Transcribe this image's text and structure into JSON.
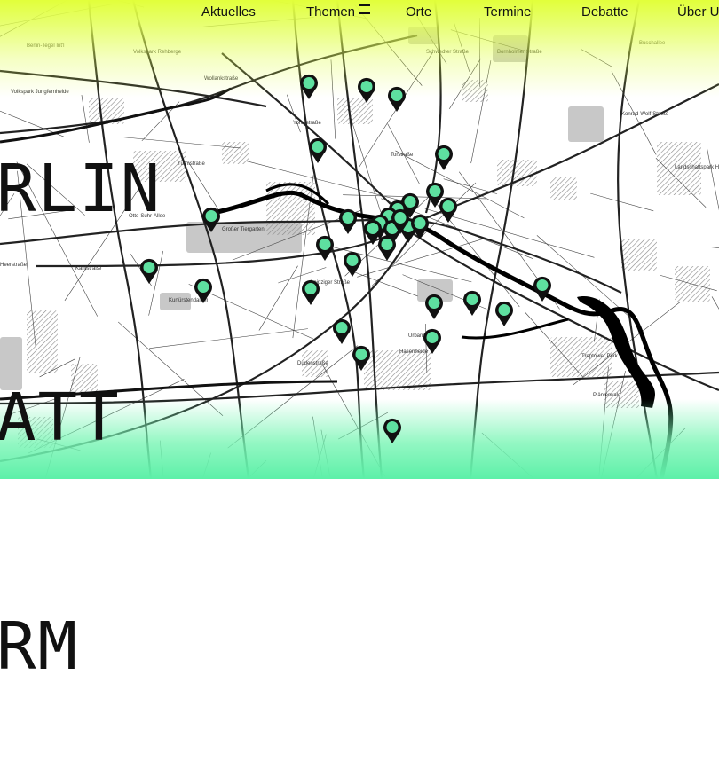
{
  "logo": {
    "line1": "RLIN",
    "line2": "ATT",
    "line3": "RM"
  },
  "nav": {
    "items": [
      "Aktuelles",
      "Themen",
      "Orte",
      "Termine",
      "Debatte",
      "Über U"
    ],
    "menu_icon": "menu-icon"
  },
  "map": {
    "labels": [
      "Berlin-Tegel Int'l",
      "Volkspark Jungfernheide",
      "Volkspark Rehberge",
      "Großer Tiergarten",
      "Treptower Park",
      "Plänterwald",
      "Landschaftspark Herzberge",
      "Turmstraße",
      "Kantstraße",
      "Otto-Suhr-Allee",
      "Torstraße",
      "Dudenstraße",
      "Urbanstraße",
      "Hasenheide",
      "Heerstraße",
      "Schwedter Straße",
      "Konrad-Wolf-Straße",
      "Buschallee",
      "Kurfürstendamm",
      "Leipziger Straße",
      "Yorckstraße",
      "Wollankstraße",
      "Bornholmer Straße"
    ],
    "marker_color": "#5ee0a0",
    "marker_count": 32
  }
}
